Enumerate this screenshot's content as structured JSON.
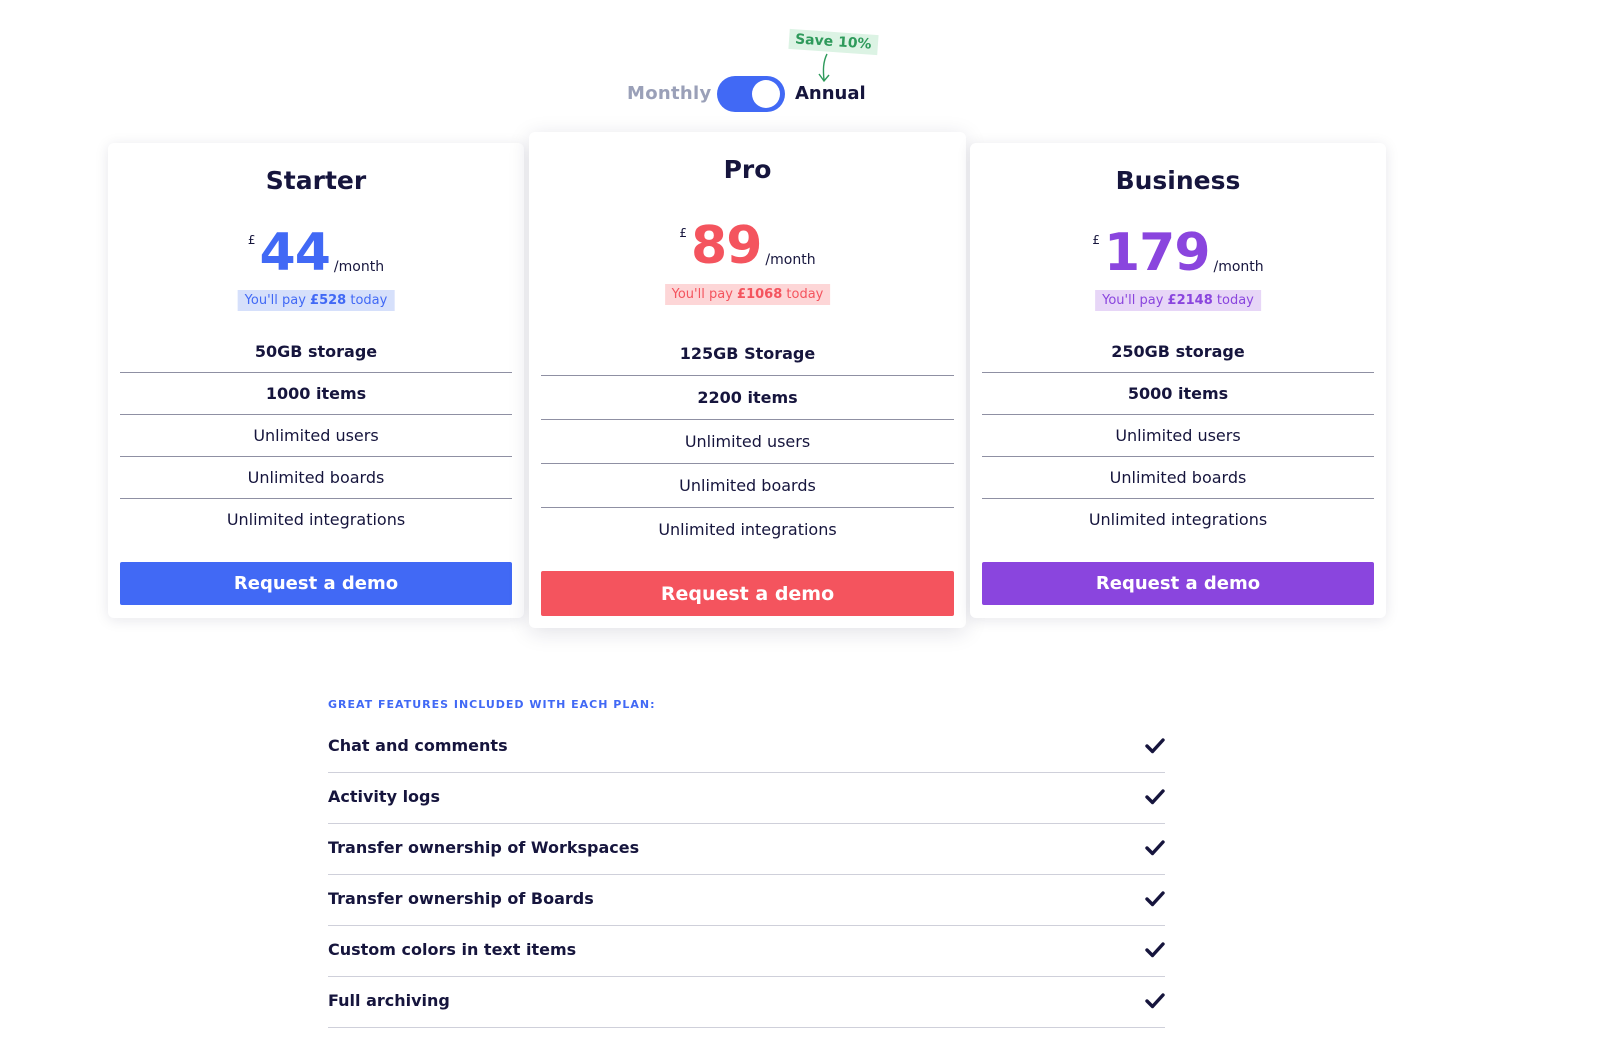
{
  "billing": {
    "monthly_label": "Monthly",
    "annual_label": "Annual",
    "annual_selected": true,
    "save_badge": "Save 10%"
  },
  "plans": [
    {
      "name": "Starter",
      "currency": "£",
      "amount": "44",
      "period": "/month",
      "pay_prefix": "You'll pay",
      "pay_amount": "£528",
      "pay_suffix": "today",
      "features": [
        "50GB storage",
        "1000 items",
        "Unlimited users",
        "Unlimited boards",
        "Unlimited integrations"
      ],
      "cta": "Request a demo"
    },
    {
      "name": "Pro",
      "currency": "£",
      "amount": "89",
      "period": "/month",
      "pay_prefix": "You'll pay",
      "pay_amount": "£1068",
      "pay_suffix": "today",
      "features": [
        "125GB Storage",
        "2200 items",
        "Unlimited users",
        "Unlimited boards",
        "Unlimited integrations"
      ],
      "cta": "Request a demo"
    },
    {
      "name": "Business",
      "currency": "£",
      "amount": "179",
      "period": "/month",
      "pay_prefix": "You'll pay",
      "pay_amount": "£2148",
      "pay_suffix": "today",
      "features": [
        "250GB storage",
        "5000 items",
        "Unlimited users",
        "Unlimited boards",
        "Unlimited integrations"
      ],
      "cta": "Request a demo"
    }
  ],
  "included": {
    "heading": "GREAT FEATURES INCLUDED WITH EACH PLAN:",
    "items": [
      "Chat and comments",
      "Activity logs",
      "Transfer ownership of Workspaces",
      "Transfer ownership of Boards",
      "Custom colors in text items",
      "Full archiving"
    ],
    "check_icon": "check-icon"
  },
  "colors": {
    "starter_accent": "#4169f5",
    "starter_badge_bg": "#d6e0fb",
    "pro_accent": "#f4545e",
    "pro_badge_bg": "#fdd6d7",
    "business_accent": "#8a45de",
    "business_badge_bg": "#e7d6f7",
    "toggle": "#4169f5",
    "save_badge_bg": "#dcf3e4",
    "save_badge_text": "#2e9a5b",
    "text_dark": "#16153d"
  }
}
